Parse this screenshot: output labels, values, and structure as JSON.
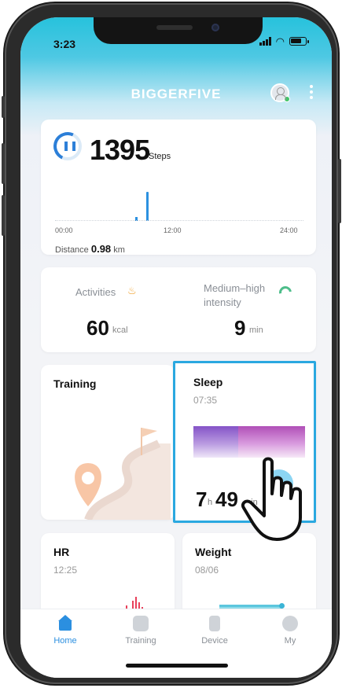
{
  "status_bar": {
    "time": "3:23"
  },
  "header": {
    "title": "BIGGERFIVE",
    "avatar_icon": "user-avatar-icon",
    "menu_icon": "more-vertical-icon"
  },
  "steps": {
    "value": "1395",
    "unit": "Steps",
    "time_labels": [
      "00:00",
      "12:00",
      "24:00"
    ],
    "distance_label": "Distance",
    "distance_value": "0.98",
    "distance_unit": "km"
  },
  "activities": {
    "label": "Activities",
    "value": "60",
    "unit": "kcal",
    "intensity_label": "Medium–high intensity",
    "intensity_value": "9",
    "intensity_unit": "min"
  },
  "tiles": {
    "training": {
      "title": "Training"
    },
    "sleep": {
      "title": "Sleep",
      "date": "07:35",
      "hours": "7",
      "hours_unit": "h",
      "minutes": "49",
      "minutes_unit": "min"
    },
    "hr": {
      "title": "HR",
      "date": "12:25"
    },
    "weight": {
      "title": "Weight",
      "date": "08/06"
    }
  },
  "tabbar": {
    "items": [
      {
        "label": "Home",
        "icon": "home-icon",
        "active": true
      },
      {
        "label": "Training",
        "icon": "training-icon",
        "active": false
      },
      {
        "label": "Device",
        "icon": "device-icon",
        "active": false
      },
      {
        "label": "My",
        "icon": "profile-icon",
        "active": false
      }
    ]
  },
  "colors": {
    "accent": "#2b8fe0",
    "header": "#27c2dc",
    "highlight_border": "#2aa8e0"
  }
}
